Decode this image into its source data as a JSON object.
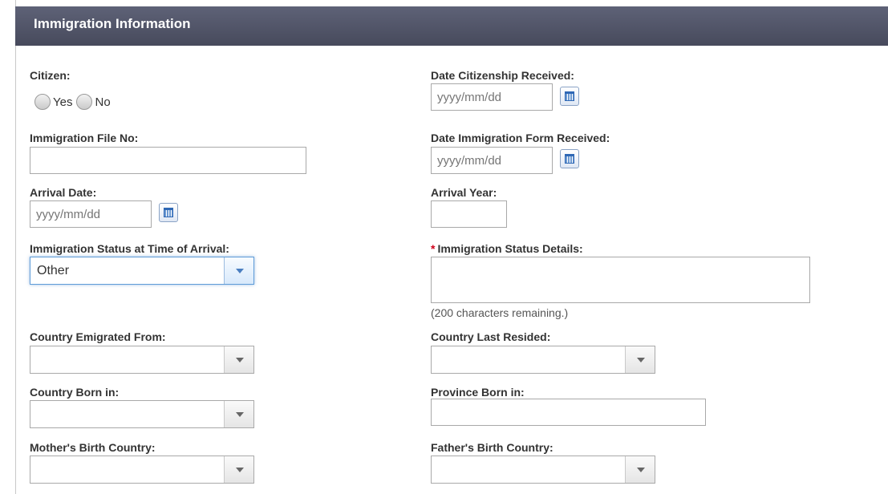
{
  "section": {
    "title": "Immigration Information"
  },
  "labels": {
    "citizen": "Citizen:",
    "date_citizenship": "Date Citizenship Received:",
    "immigration_file_no": "Immigration File No:",
    "date_immigration_form": "Date Immigration Form Received:",
    "arrival_date": "Arrival Date:",
    "arrival_year": "Arrival Year:",
    "immigration_status_arrival": "Immigration Status at Time of Arrival:",
    "immigration_status_details": "Immigration Status Details:",
    "country_emigrated_from": "Country Emigrated From:",
    "country_last_resided": "Country Last Resided:",
    "country_born_in": "Country Born in:",
    "province_born_in": "Province Born in:",
    "mother_birth_country": "Mother's Birth Country:",
    "father_birth_country": "Father's Birth Country:"
  },
  "radios": {
    "yes": "Yes",
    "no": "No"
  },
  "placeholders": {
    "date": "yyyy/mm/dd"
  },
  "values": {
    "immigration_status_arrival": "Other",
    "chars_remaining": "(200 characters remaining.)"
  },
  "required_marker": "*",
  "colors": {
    "header": "#4f5366",
    "required": "#d0021b",
    "focus_border": "#5f9cd8"
  }
}
